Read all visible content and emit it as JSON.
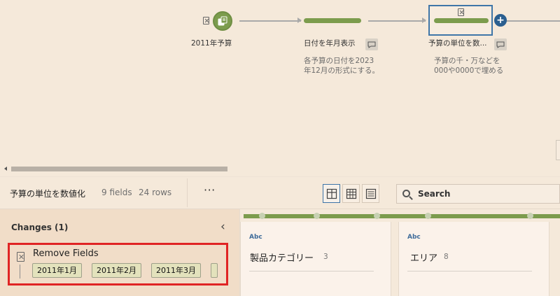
{
  "flow": {
    "nodes": [
      {
        "label": "2011年予算"
      },
      {
        "label": "日付を年月表示",
        "description_line1": "各予算の日付を2023",
        "description_line2": "年12月の形式にする。"
      },
      {
        "label": "予算の単位を数...",
        "description_line1": "予算の千・万などを",
        "description_line2": "000や0000で埋める"
      }
    ]
  },
  "toolbar": {
    "title": "予算の単位を数値化",
    "fields": "9 fields",
    "rows": "24 rows",
    "more": "···",
    "search_placeholder": "Search"
  },
  "changes": {
    "title": "Changes (1)",
    "collapse_icon": "chevron-left-icon",
    "items": [
      {
        "title": "Remove Fields",
        "fields": [
          "2011年1月",
          "2011年2月",
          "2011年3月"
        ]
      }
    ]
  },
  "fields": [
    {
      "type": "Abc",
      "name": "製品カテゴリー",
      "count": "3"
    },
    {
      "type": "Abc",
      "name": "エリア",
      "count": "8"
    }
  ],
  "colors": {
    "background": "#f5e9da",
    "accent_green": "#7c9c4d",
    "selection_blue": "#3f76a8",
    "highlight_red": "#e02424"
  }
}
